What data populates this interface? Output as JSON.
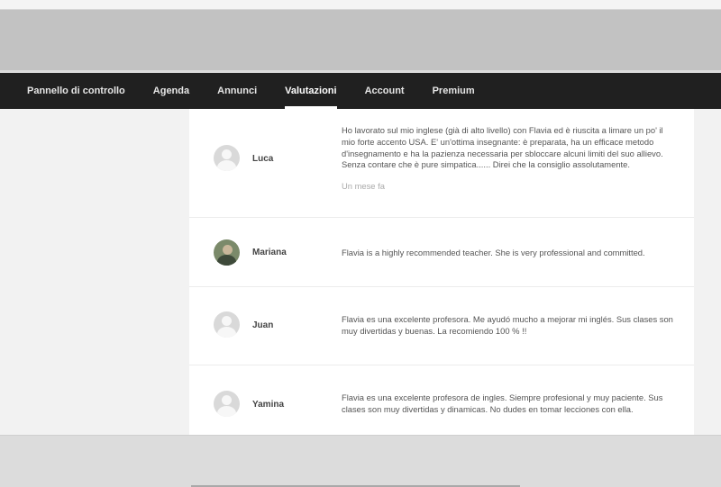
{
  "nav": {
    "items": [
      {
        "label": "Pannello di controllo"
      },
      {
        "label": "Agenda"
      },
      {
        "label": "Annunci"
      },
      {
        "label": "Valutazioni",
        "active": true
      },
      {
        "label": "Account"
      },
      {
        "label": "Premium"
      }
    ]
  },
  "reviews": [
    {
      "name": "Luca",
      "text": "Ho lavorato sul mio inglese (già di alto livello) con Flavia ed è riuscita a limare un po' il mio forte accento USA. E' un'ottima insegnante: è preparata, ha un efficace metodo d'insegnamento e ha la pazienza necessaria per sbloccare alcuni limiti del suo allievo. Senza contare che è pure simpatica...... Direi che la consiglio assolutamente.",
      "time": "Un mese fa",
      "avatar": "default-avatar-icon"
    },
    {
      "name": "Mariana",
      "text": "Flavia is a highly recommended teacher. She is very professional and committed.",
      "avatar": "photo-avatar"
    },
    {
      "name": "Juan",
      "text": "Flavia es una excelente profesora. Me ayudó mucho a mejorar mi inglés. Sus clases son muy divertidas y buenas. La recomiendo 100 % !!",
      "avatar": "default-avatar-icon"
    },
    {
      "name": "Yamina",
      "text": "Flavia es una excelente profesora de ingles. Siempre profesional y muy paciente. Sus clases son muy divertidas y dinamicas. No dudes en tomar lecciones con ella.",
      "avatar": "default-avatar-icon"
    }
  ],
  "colors": {
    "navbar_bg": "#202020",
    "nav_text": "#e6e6e6",
    "header_band": "#c2c2c2",
    "page_bg": "#f2f2f2",
    "card_bg": "#ffffff"
  }
}
